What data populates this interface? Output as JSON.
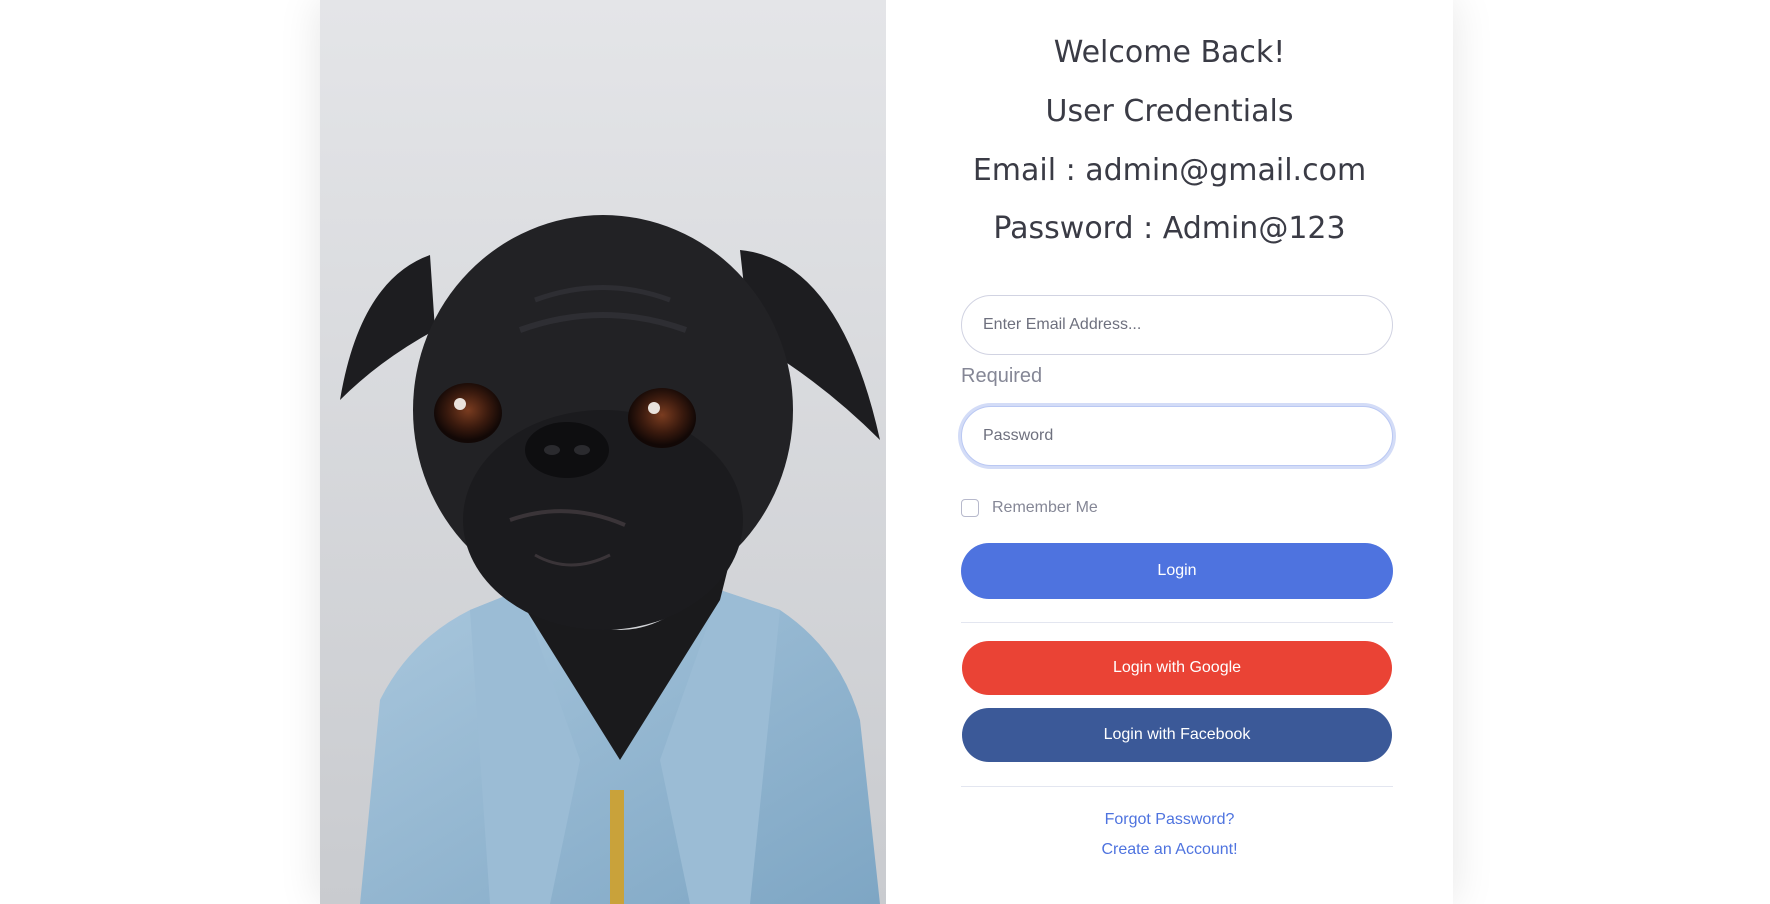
{
  "header": {
    "welcome": "Welcome Back!",
    "credentials_title": "User Credentials",
    "email_line": "Email : admin@gmail.com",
    "password_line": "Password : Admin@123"
  },
  "form": {
    "email": {
      "value": "",
      "placeholder": "Enter Email Address..."
    },
    "email_error": "Required",
    "password": {
      "value": "",
      "placeholder": "Password"
    },
    "remember_label": "Remember Me",
    "remember_checked": false
  },
  "buttons": {
    "login": "Login",
    "google": "Login with Google",
    "facebook": "Login with Facebook"
  },
  "links": {
    "forgot": "Forgot Password?",
    "create": "Create an Account!"
  },
  "colors": {
    "primary": "#4e73df",
    "google": "#ea4335",
    "facebook": "#3b5998",
    "text": "#3a3b45",
    "muted": "#858796"
  },
  "image": {
    "subject": "pug-in-denim-jacket"
  }
}
